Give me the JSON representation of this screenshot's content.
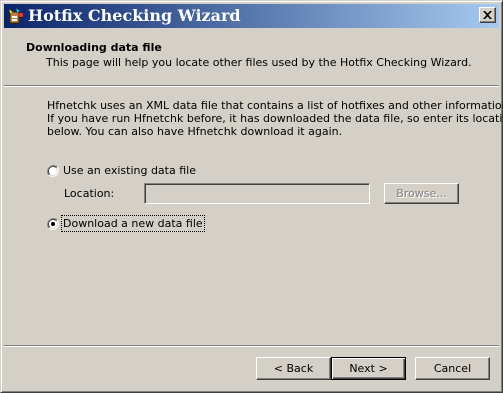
{
  "window": {
    "title": "Hotfix Checking Wizard",
    "icon": "wizard-app-icon",
    "close_icon": "close-icon"
  },
  "header": {
    "heading": "Downloading data file",
    "subheading": "This page will help you locate other files used by the Hotfix Checking Wizard."
  },
  "description": {
    "lines": [
      "Hfnetchk uses an XML data file that contains a list of hotfixes and other information.",
      "If you have run Hfnetchk before, it has downloaded the data file, so enter its location",
      "below.  You can also have Hfnetchk download it again."
    ]
  },
  "options": {
    "existing": {
      "label": "Use an existing data file",
      "selected": false
    },
    "download": {
      "label": "Download a new data file",
      "selected": true
    }
  },
  "location": {
    "label": "Location:",
    "value": "",
    "browse_label": "Browse..."
  },
  "footer": {
    "back_label": "< Back",
    "next_label": "Next >",
    "cancel_label": "Cancel"
  }
}
